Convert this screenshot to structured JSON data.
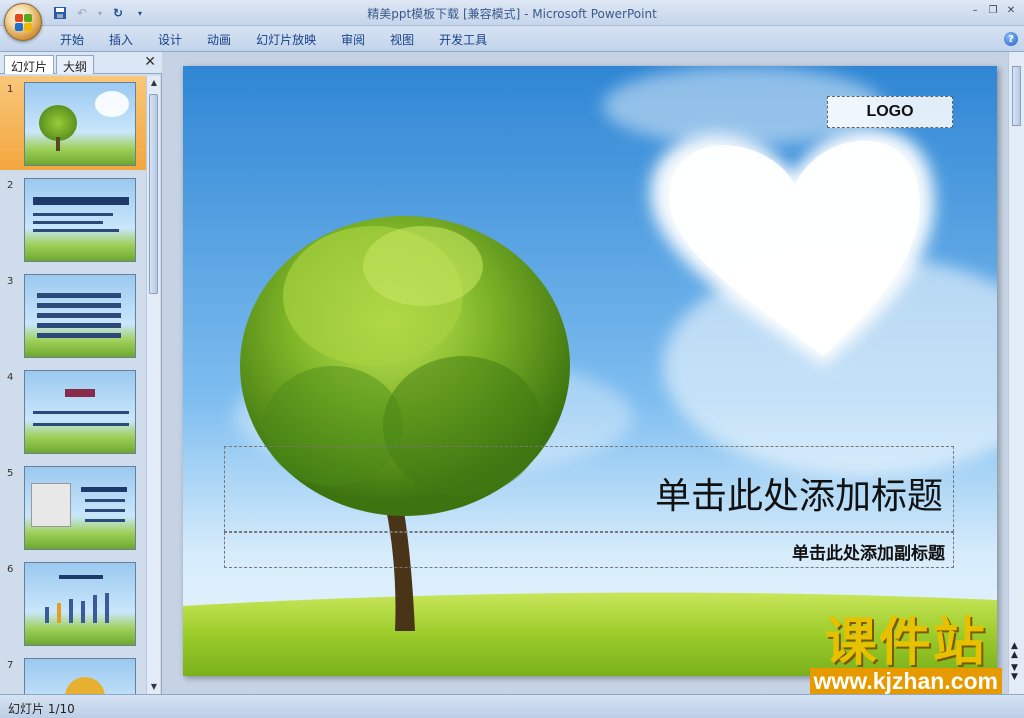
{
  "window": {
    "title": "精美ppt模板下载 [兼容模式] - Microsoft PowerPoint"
  },
  "quick_access": {
    "icons": [
      "save-icon",
      "undo-icon",
      "redo-icon",
      "customize-dropdown-icon"
    ]
  },
  "ribbon": {
    "tabs": [
      "开始",
      "插入",
      "设计",
      "动画",
      "幻灯片放映",
      "审阅",
      "视图",
      "开发工具"
    ]
  },
  "left_pane": {
    "tabs": [
      "幻灯片",
      "大纲"
    ],
    "slide_numbers": [
      "1",
      "2",
      "3",
      "4",
      "5",
      "6",
      "7"
    ],
    "selected_slide": "1"
  },
  "slide": {
    "logo_text": "LOGO",
    "title_placeholder": "单击此处添加标题",
    "subtitle_placeholder": "单击此处添加副标题"
  },
  "watermark": {
    "brand": "课件站",
    "url": "www.kjzhan.com"
  },
  "status_bar": {
    "slide_counter": "幻灯片 1/10"
  },
  "colors": {
    "ribbon_text": "#15428b",
    "selected_thumb": "#f3a73e",
    "watermark_yellow": "#e7c000",
    "watermark_orange": "#e79a00"
  }
}
